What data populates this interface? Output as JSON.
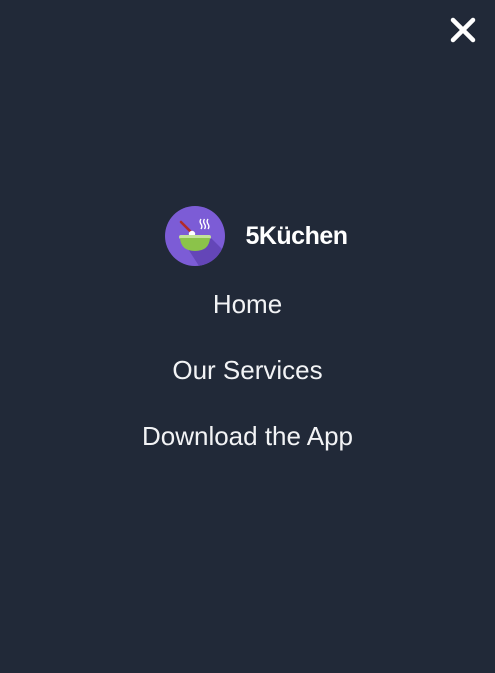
{
  "menu": {
    "close_icon": "close-icon",
    "brand": {
      "name": "5Küchen",
      "logo_icon": "bowl-logo-icon"
    },
    "items": [
      {
        "label": "Home"
      },
      {
        "label": "Our Services"
      },
      {
        "label": "Download the App"
      }
    ]
  },
  "colors": {
    "background": "#212938",
    "text": "#ffffff",
    "logo_circle": "#7c5cd6",
    "bowl": "#8bc34a"
  }
}
